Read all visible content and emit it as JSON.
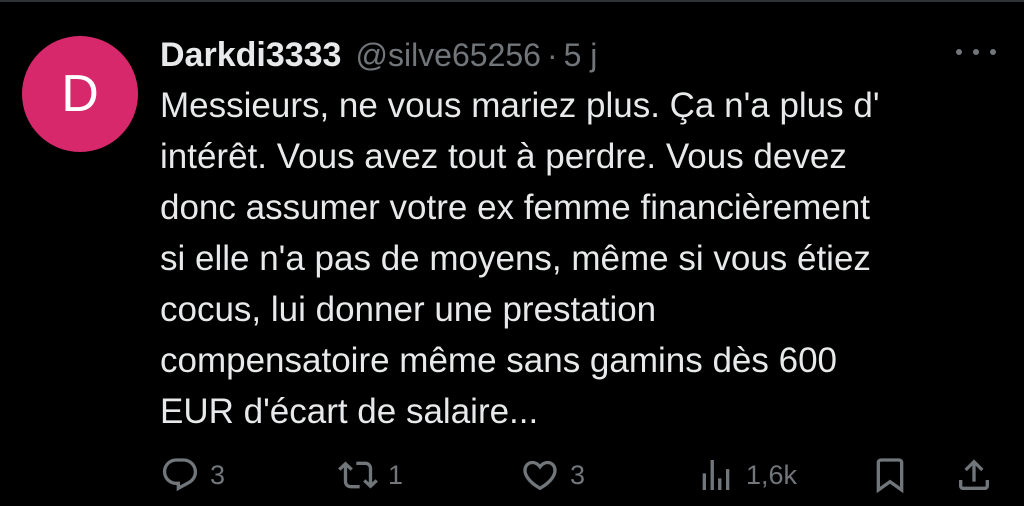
{
  "tweet": {
    "avatar_letter": "D",
    "avatar_color": "#d6286b",
    "display_name": "Darkdi3333",
    "handle": "@silve65256",
    "separator": "·",
    "age": "5 j",
    "text": "Messieurs, ne vous mariez plus. Ça n'a plus d'\nintérêt. Vous avez tout à perdre. Vous devez\ndonc assumer votre ex femme financièrement\nsi elle n'a pas de moyens, même si vous étiez\ncocus, lui donner une prestation\ncompensatoire même sans gamins dès 600\nEUR d'écart de salaire..."
  },
  "actions": {
    "reply": {
      "icon": "reply-icon",
      "count": "3"
    },
    "repost": {
      "icon": "repost-icon",
      "count": "1"
    },
    "like": {
      "icon": "heart-icon",
      "count": "3"
    },
    "views": {
      "icon": "views-icon",
      "count": "1,6k"
    },
    "bookmark": {
      "icon": "bookmark-icon"
    },
    "share": {
      "icon": "share-icon"
    }
  },
  "colors": {
    "background": "#000000",
    "text": "#e7e9ea",
    "muted": "#71767b"
  }
}
